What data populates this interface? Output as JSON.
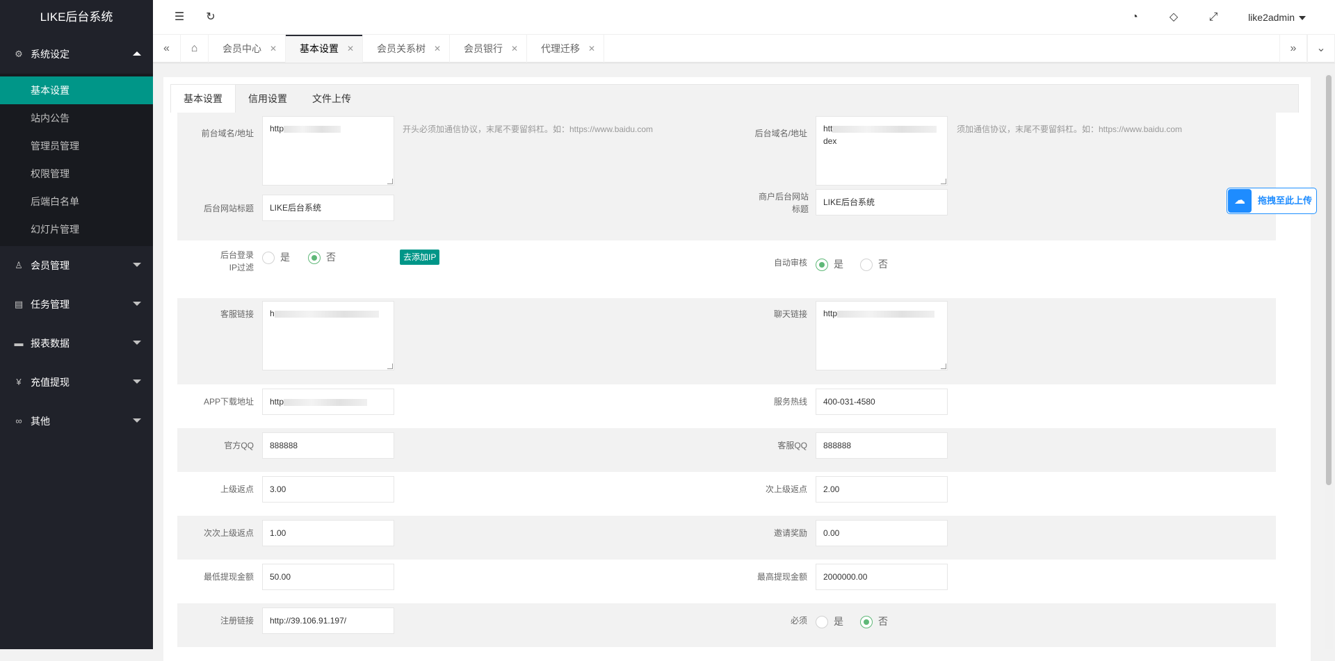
{
  "app": {
    "title": "LIKE后台系统"
  },
  "sidebar": {
    "groups": [
      {
        "label": "系统设定",
        "icon": "gear-icon",
        "glyph": "⚙"
      },
      {
        "label": "会员管理",
        "icon": "user-icon",
        "glyph": "♙"
      },
      {
        "label": "任务管理",
        "icon": "task-icon",
        "glyph": "▤"
      },
      {
        "label": "报表数据",
        "icon": "report-icon",
        "glyph": "▬"
      },
      {
        "label": "充值提现",
        "icon": "yen-icon",
        "glyph": "¥"
      },
      {
        "label": "其他",
        "icon": "link-icon",
        "glyph": "∞"
      }
    ],
    "subitems": [
      "基本设置",
      "站内公告",
      "管理员管理",
      "权限管理",
      "后端白名单",
      "幻灯片管理"
    ]
  },
  "topbar": {
    "user": "like2admin"
  },
  "tabbar": {
    "tabs": [
      "会员中心",
      "基本设置",
      "会员关系树",
      "会员银行",
      "代理迁移"
    ]
  },
  "content_tabs": [
    "基本设置",
    "信用设置",
    "文件上传"
  ],
  "form": {
    "frontend_domain": {
      "label": "前台域名/地址",
      "value": "http",
      "hint": "开头必须加通信协议，末尾不要留斜杠。如：https://www.baidu.com"
    },
    "backend_domain": {
      "label": "后台域名/地址",
      "value_line1": "htt",
      "value_line2": "dex",
      "hint": "须加通信协议，末尾不要留斜杠。如：https://www.baidu.com"
    },
    "backend_title": {
      "label": "后台网站标题",
      "value": "LIKE后台系统"
    },
    "merchant_title": {
      "label": "商户后台网站标题",
      "value": "LIKE后台系统"
    },
    "ip_filter": {
      "label": "后台登录IP过滤",
      "yes": "是",
      "no": "否",
      "selected": "否",
      "button": "去添加IP"
    },
    "auto_review": {
      "label": "自动审核",
      "yes": "是",
      "no": "否",
      "selected": "是"
    },
    "service_link": {
      "label": "客服链接",
      "value": "h"
    },
    "chat_link": {
      "label": "聊天链接",
      "value": "http"
    },
    "app_download": {
      "label": "APP下载地址",
      "value": "http"
    },
    "hotline": {
      "label": "服务热线",
      "value": "400-031-4580"
    },
    "official_qq": {
      "label": "官方QQ",
      "value": "888888"
    },
    "service_qq": {
      "label": "客服QQ",
      "value": "888888"
    },
    "upper_rebate": {
      "label": "上级返点",
      "value": "3.00"
    },
    "second_rebate": {
      "label": "次上级返点",
      "value": "2.00"
    },
    "third_rebate": {
      "label": "次次上级返点",
      "value": "1.00"
    },
    "invite_reward": {
      "label": "邀请奖励",
      "value": "0.00"
    },
    "min_withdraw": {
      "label": "最低提现金额",
      "value": "50.00"
    },
    "max_withdraw": {
      "label": "最高提现金额",
      "value": "2000000.00"
    },
    "register_link": {
      "label": "注册链接",
      "value": "http://39.106.91.197/"
    },
    "required": {
      "label": "必须",
      "yes": "是",
      "no": "否",
      "selected": "否"
    }
  },
  "upload_widget": {
    "label": "拖拽至此上传"
  },
  "colors": {
    "sidebar_bg": "#20222a",
    "active_green": "#009688",
    "radio_green": "#5fb878",
    "upload_blue": "#1e8cff"
  }
}
